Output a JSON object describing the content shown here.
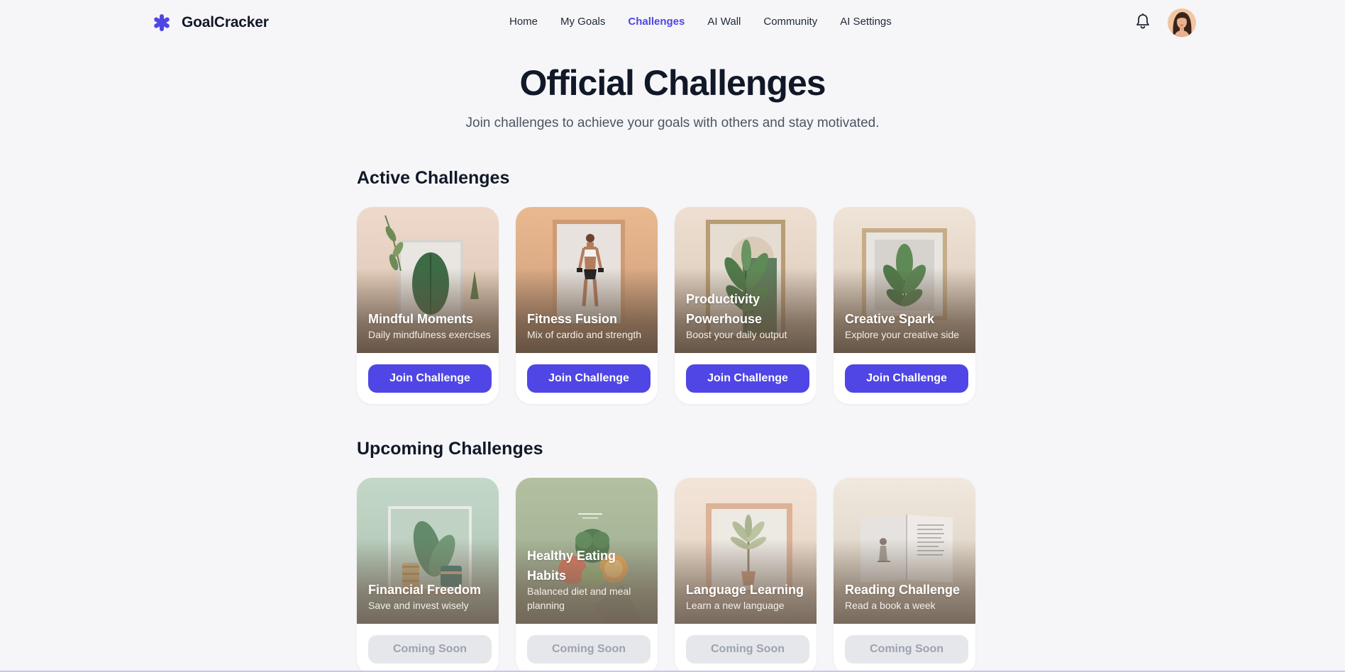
{
  "app": {
    "name": "GoalCracker"
  },
  "nav": {
    "links": [
      {
        "label": "Home",
        "active": false
      },
      {
        "label": "My Goals",
        "active": false
      },
      {
        "label": "Challenges",
        "active": true
      },
      {
        "label": "AI Wall",
        "active": false
      },
      {
        "label": "Community",
        "active": false
      },
      {
        "label": "AI Settings",
        "active": false
      }
    ],
    "icons": [
      "bell-icon",
      "avatar"
    ]
  },
  "hero": {
    "title": "Official Challenges",
    "subtitle": "Join challenges to achieve your goals with others and stay motivated."
  },
  "active": {
    "heading": "Active Challenges",
    "button_label": "Join Challenge",
    "cards": [
      {
        "title": "Mindful Moments",
        "description": "Daily mindfulness exercises"
      },
      {
        "title": "Fitness Fusion",
        "description": "Mix of cardio and strength"
      },
      {
        "title": "Productivity Powerhouse",
        "description": "Boost your daily output"
      },
      {
        "title": "Creative Spark",
        "description": "Explore your creative side"
      }
    ]
  },
  "upcoming": {
    "heading": "Upcoming Challenges",
    "button_label": "Coming Soon",
    "cards": [
      {
        "title": "Financial Freedom",
        "description": "Save and invest wisely"
      },
      {
        "title": "Healthy Eating Habits",
        "description": "Balanced diet and meal planning"
      },
      {
        "title": "Language Learning",
        "description": "Learn a new language"
      },
      {
        "title": "Reading Challenge",
        "description": "Read a book a week"
      }
    ]
  },
  "colors": {
    "accent": "#4f46e5",
    "background": "#f6f6f9",
    "disabled_button": "#e5e7eb",
    "disabled_text": "#9ca3af"
  }
}
